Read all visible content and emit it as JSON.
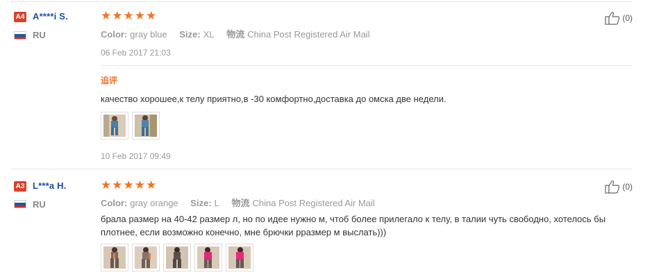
{
  "reviews": [
    {
      "level": "A4",
      "name": "A****i S.",
      "country": "RU",
      "rating": 5,
      "attrs": [
        {
          "key": "Color:",
          "value": "gray blue"
        },
        {
          "key": "Size:",
          "value": "XL"
        },
        {
          "key": "物流",
          "value": "China Post Registered Air Mail"
        }
      ],
      "date": "06 Feb 2017 21:03",
      "additional_label": "追评",
      "text": "качество хорошее,к телу приятно,в -30 комфортно,доставка до омска две недели.",
      "photo_count": 2,
      "followup_date": "10 Feb 2017 09:49",
      "likes": "(0)"
    },
    {
      "level": "A3",
      "name": "L***a H.",
      "country": "RU",
      "rating": 5,
      "attrs": [
        {
          "key": "Color:",
          "value": "gray orange"
        },
        {
          "key": "Size:",
          "value": "L"
        },
        {
          "key": "物流",
          "value": "China Post Registered Air Mail"
        }
      ],
      "text": "брала размер на 40-42 размер л, но по идее нужно м, чтоб более прилегало к телу, в талии чуть свободно, хотелось бы плотнее, если возможно конечно, мне брючки рразмер м выслать)))",
      "photo_count": 5,
      "likes": "(0)"
    }
  ],
  "colors": {
    "star": "#f57224",
    "level_badge": "#d9412b",
    "username": "#1a4ea1",
    "additional": "#f57224"
  },
  "icons": {
    "like": "thumbs-up-icon",
    "flag": "russia-flag-icon",
    "star": "star-icon"
  }
}
